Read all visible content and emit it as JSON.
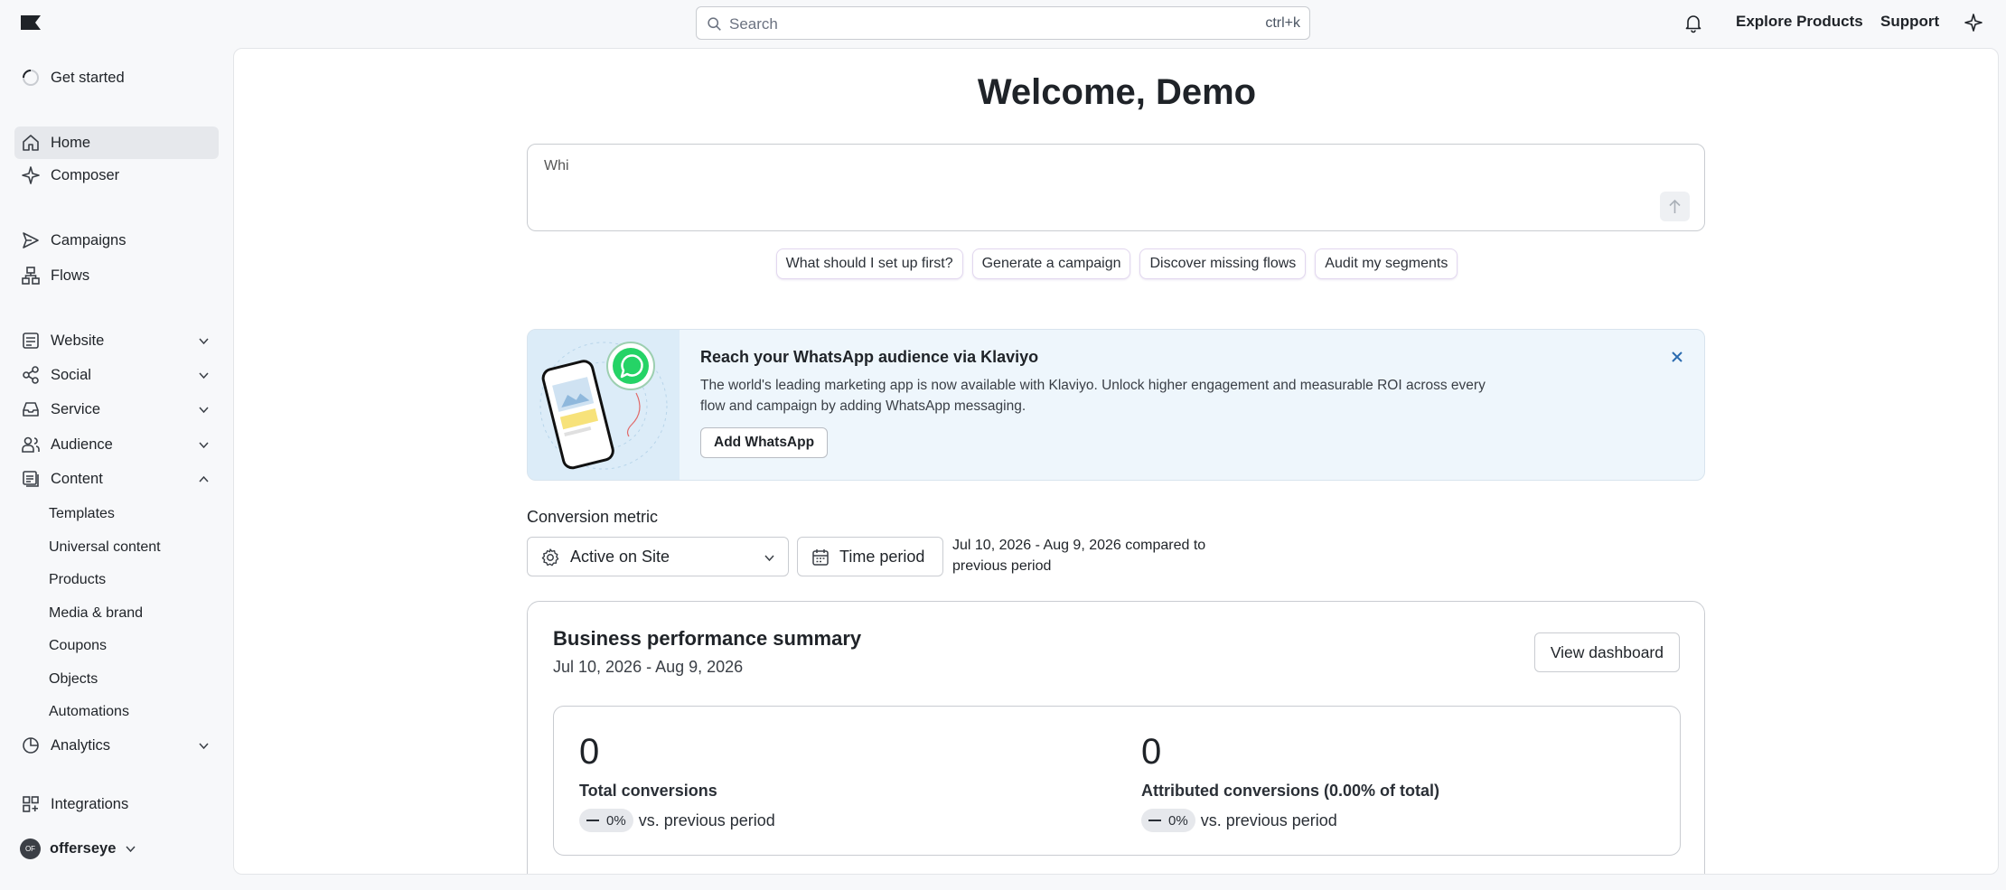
{
  "header": {
    "search_placeholder": "Search",
    "search_shortcut": "ctrl+k",
    "links": [
      "Explore Products",
      "Support"
    ]
  },
  "sidebar": {
    "get_started": "Get started",
    "items": [
      {
        "label": "Home",
        "icon": "home-icon",
        "active": true
      },
      {
        "label": "Composer",
        "icon": "sparkle-icon"
      },
      {
        "label": "Campaigns",
        "icon": "send-icon"
      },
      {
        "label": "Flows",
        "icon": "flows-icon"
      },
      {
        "label": "Website",
        "icon": "website-icon",
        "expandable": true
      },
      {
        "label": "Social",
        "icon": "social-icon",
        "expandable": true
      },
      {
        "label": "Service",
        "icon": "inbox-icon",
        "expandable": true
      },
      {
        "label": "Audience",
        "icon": "audience-icon",
        "expandable": true
      },
      {
        "label": "Content",
        "icon": "content-icon",
        "expanded": true
      },
      {
        "label": "Analytics",
        "icon": "analytics-icon",
        "expandable": true
      },
      {
        "label": "Integrations",
        "icon": "integrations-icon"
      }
    ],
    "content_subitems": [
      "Templates",
      "Universal content",
      "Products",
      "Media & brand",
      "Coupons",
      "Objects",
      "Automations"
    ],
    "account": {
      "initials": "OF",
      "name": "offerseye"
    }
  },
  "main": {
    "welcome": "Welcome, Demo",
    "composer_text": "Whi",
    "suggestions": [
      "What should I set up first?",
      "Generate a campaign",
      "Discover missing flows",
      "Audit my segments"
    ],
    "promo": {
      "title": "Reach your WhatsApp audience via Klaviyo",
      "body": "The world's leading marketing app is now available with Klaviyo. Unlock higher engagement and measurable ROI across every flow and campaign by adding WhatsApp messaging.",
      "button": "Add WhatsApp"
    },
    "conversion_metric_label": "Conversion metric",
    "conversion_metric_value": "Active on Site",
    "time_period_label": "Time period",
    "range_text": "Jul 10, 2026 - Aug 9, 2026 compared to previous period",
    "performance": {
      "title": "Business performance summary",
      "date_range": "Jul 10, 2026 - Aug 9, 2026",
      "view_dashboard": "View dashboard",
      "kpis": [
        {
          "value": "0",
          "label": "Total conversions",
          "change": "0%",
          "compare": "vs. previous period"
        },
        {
          "value": "0",
          "label": "Attributed conversions (0.00% of total)",
          "change": "0%",
          "compare": "vs. previous period"
        }
      ]
    }
  },
  "colors": {
    "accent_whatsapp": "#25d366",
    "active_nav": "#e6e8ec",
    "promo_bg": "#eef6fc"
  }
}
